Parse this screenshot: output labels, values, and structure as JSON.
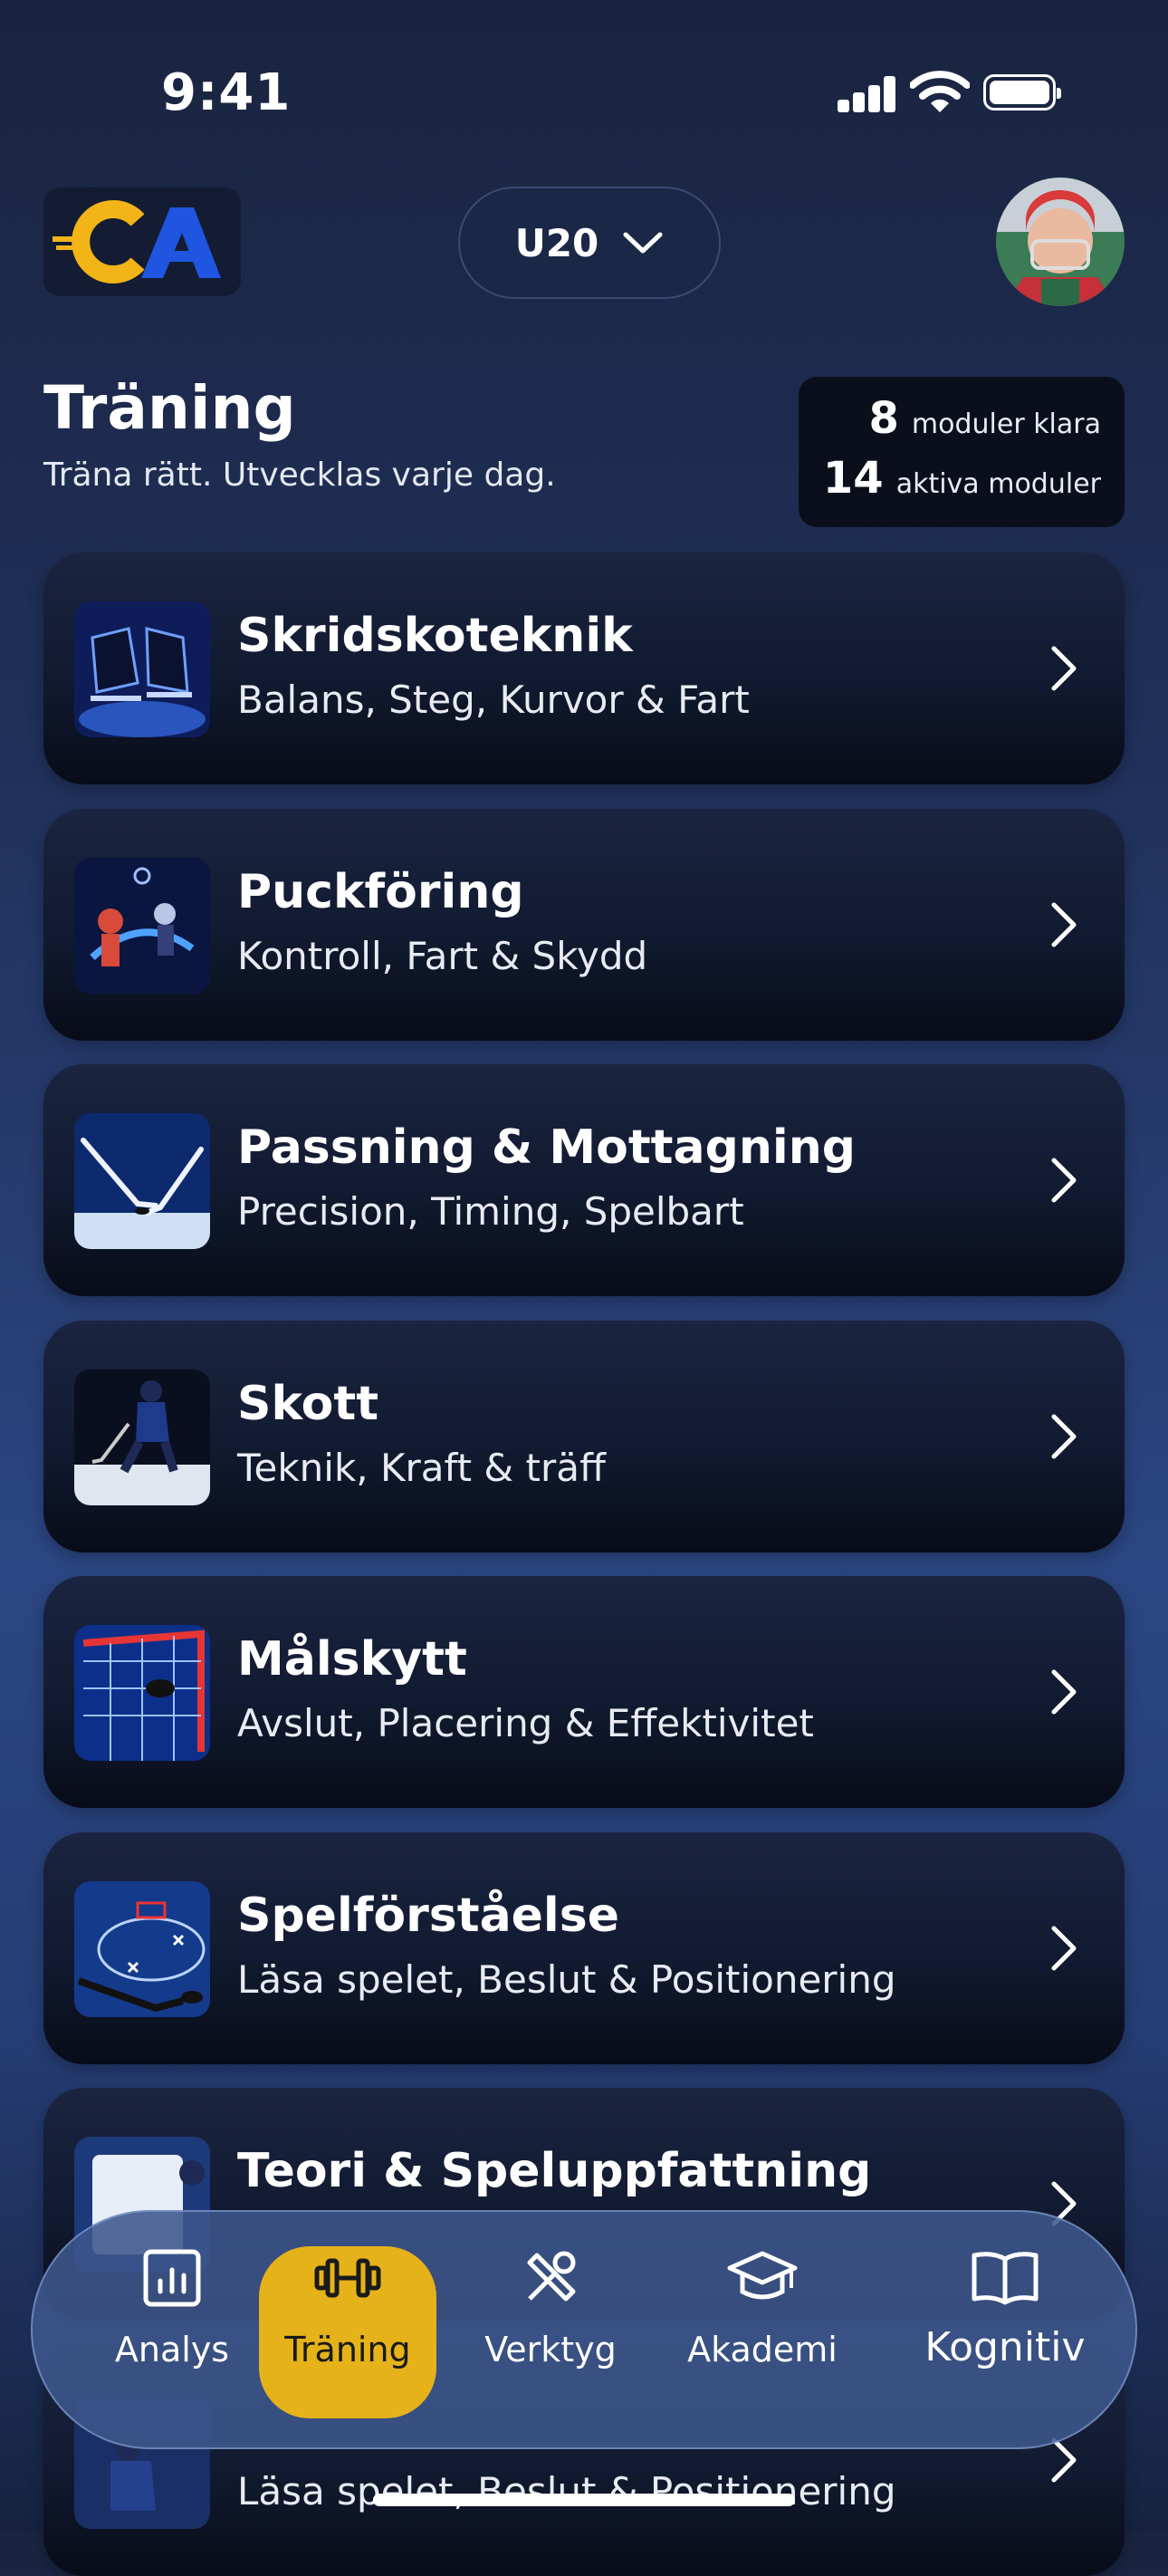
{
  "status_bar": {
    "time": "9:41"
  },
  "header": {
    "logo_text": "CA",
    "team": "U20",
    "colors": {
      "logo_yellow": "#f2b417",
      "logo_blue": "#1f55e0",
      "accent": "#e5b21a"
    }
  },
  "page": {
    "title": "Träning",
    "subtitle": "Träna rätt. Utvecklas varje dag.",
    "stats": [
      {
        "value": "8",
        "label": "moduler klara"
      },
      {
        "value": "14",
        "label": "aktiva moduler"
      }
    ]
  },
  "modules": [
    {
      "title": "Skridskoteknik",
      "subtitle": "Balans, Steg, Kurvor & Fart",
      "icon": "skates-image"
    },
    {
      "title": "Puckföring",
      "subtitle": "Kontroll, Fart & Skydd",
      "icon": "puck-handling-image"
    },
    {
      "title": "Passning & Mottagning",
      "subtitle": "Precision, Timing, Spelbart",
      "icon": "passing-sticks-image"
    },
    {
      "title": "Skott",
      "subtitle": "Teknik, Kraft & träff",
      "icon": "shooting-player-image"
    },
    {
      "title": "Målskytt",
      "subtitle": "Avslut, Placering & Effektivitet",
      "icon": "goal-net-image"
    },
    {
      "title": "Spelförståelse",
      "subtitle": "Läsa spelet, Beslut & Positionering",
      "icon": "tactics-board-image"
    },
    {
      "title": "Teori & Speluppfattning",
      "subtitle": "",
      "icon": "theory-image"
    },
    {
      "title": "",
      "subtitle": "Läsa spelet, Beslut & Positionering",
      "icon": "player-image"
    }
  ],
  "nav": {
    "items": [
      {
        "label": "Analys",
        "icon": "bar-chart-icon"
      },
      {
        "label": "Träning",
        "icon": "dumbbell-icon",
        "active": true
      },
      {
        "label": "Verktyg",
        "icon": "tools-icon"
      },
      {
        "label": "Akademi",
        "icon": "graduation-cap-icon"
      },
      {
        "label": "Kognitiv",
        "icon": "book-icon"
      }
    ]
  }
}
